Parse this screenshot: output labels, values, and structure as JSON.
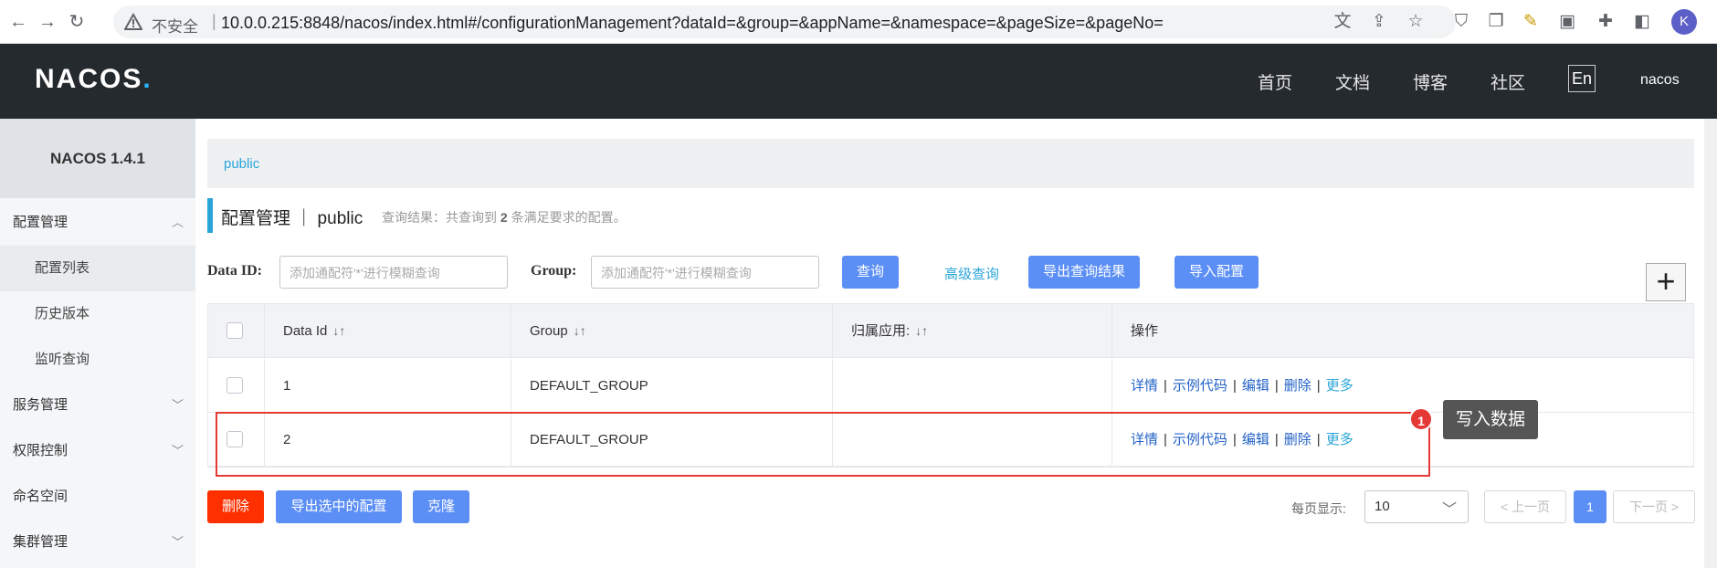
{
  "browser": {
    "insecure_label": "不安全",
    "url": "10.0.0.215:8848/nacos/index.html#/configurationManagement?dataId=&group=&appName=&namespace=&pageSize=&pageNo=",
    "avatar_letter": "K"
  },
  "header": {
    "logo": "NACOS",
    "logo_dot": ".",
    "nav": [
      "首页",
      "文档",
      "博客",
      "社区"
    ],
    "lang": "En",
    "user": "nacos"
  },
  "sidebar": {
    "version": "NACOS 1.4.1",
    "items": [
      {
        "label": "配置管理",
        "chevron": "︿"
      },
      {
        "label": "配置列表"
      },
      {
        "label": "历史版本"
      },
      {
        "label": "监听查询"
      },
      {
        "label": "服务管理",
        "chevron": "﹀"
      },
      {
        "label": "权限控制",
        "chevron": "﹀"
      },
      {
        "label": "命名空间"
      },
      {
        "label": "集群管理",
        "chevron": "﹀"
      }
    ]
  },
  "main": {
    "namespace_crumb": "public",
    "title": "配置管理 ｜ public",
    "result_prefix": "查询结果：共查询到 ",
    "result_count": "2",
    "result_suffix": " 条满足要求的配置。",
    "dataid_label": "Data ID:",
    "dataid_placeholder": "添加通配符'*'进行模糊查询",
    "group_label": "Group:",
    "group_placeholder": "添加通配符'*'进行模糊查询",
    "query_btn": "查询",
    "advanced_query": "高级查询",
    "export_results_btn": "导出查询结果",
    "import_btn": "导入配置",
    "plus": "+"
  },
  "table": {
    "headers": [
      "Data Id",
      "Group",
      "归属应用:",
      "操作"
    ],
    "sort_icon": "↓↑",
    "rows": [
      {
        "data_id": "1",
        "group": "DEFAULT_GROUP",
        "app": ""
      },
      {
        "data_id": "2",
        "group": "DEFAULT_GROUP",
        "app": ""
      }
    ],
    "ops": [
      "详情",
      "示例代码",
      "编辑",
      "删除"
    ],
    "more": "更多",
    "sep": "|"
  },
  "annotation": {
    "badge": "1",
    "tip": "写入数据",
    "color": "#e53935"
  },
  "footer": {
    "delete_btn": "删除",
    "export_selected_btn": "导出选中的配置",
    "clone_btn": "克隆",
    "page_size_label": "每页显示:",
    "page_size": "10",
    "prev": "< 上一页",
    "current_page": "1",
    "next": "下一页 >"
  },
  "colors": {
    "header_bg": "#252a2f",
    "primary": "#5c8ff5",
    "danger": "#ff3000",
    "link": "#2aa5d9"
  }
}
